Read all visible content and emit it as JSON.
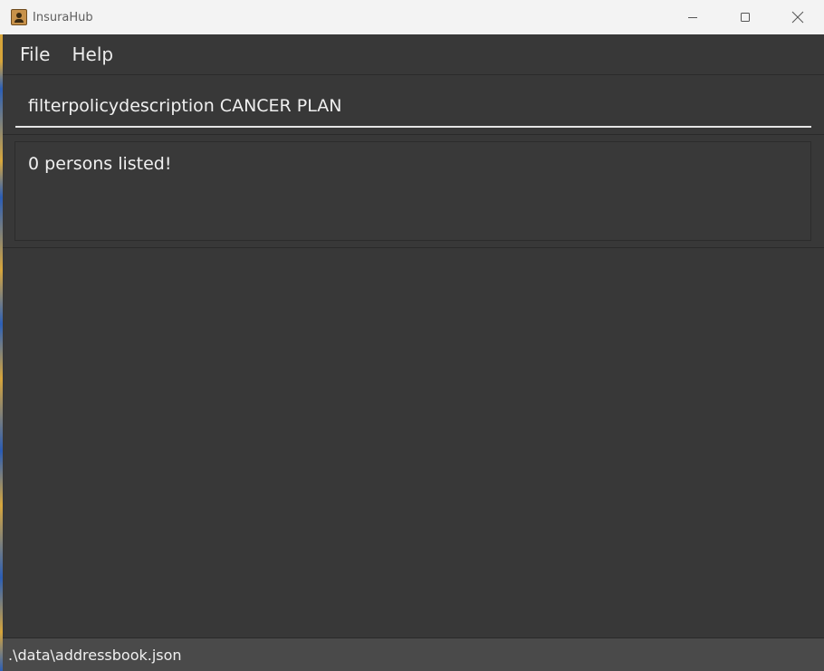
{
  "window": {
    "title": "InsuraHub",
    "icon": "app-icon"
  },
  "menu": {
    "items": [
      {
        "label": "File"
      },
      {
        "label": "Help"
      }
    ]
  },
  "command": {
    "value": "filterpolicydescription CANCER PLAN"
  },
  "result": {
    "message": "0 persons listed!"
  },
  "person_list": {
    "count": 0
  },
  "status": {
    "file_path": ".\\data\\addressbook.json"
  },
  "colors": {
    "background": "#383838",
    "titlebar": "#f3f3f3",
    "text": "#f0f0f0",
    "statusbar": "#4a4a4a"
  }
}
